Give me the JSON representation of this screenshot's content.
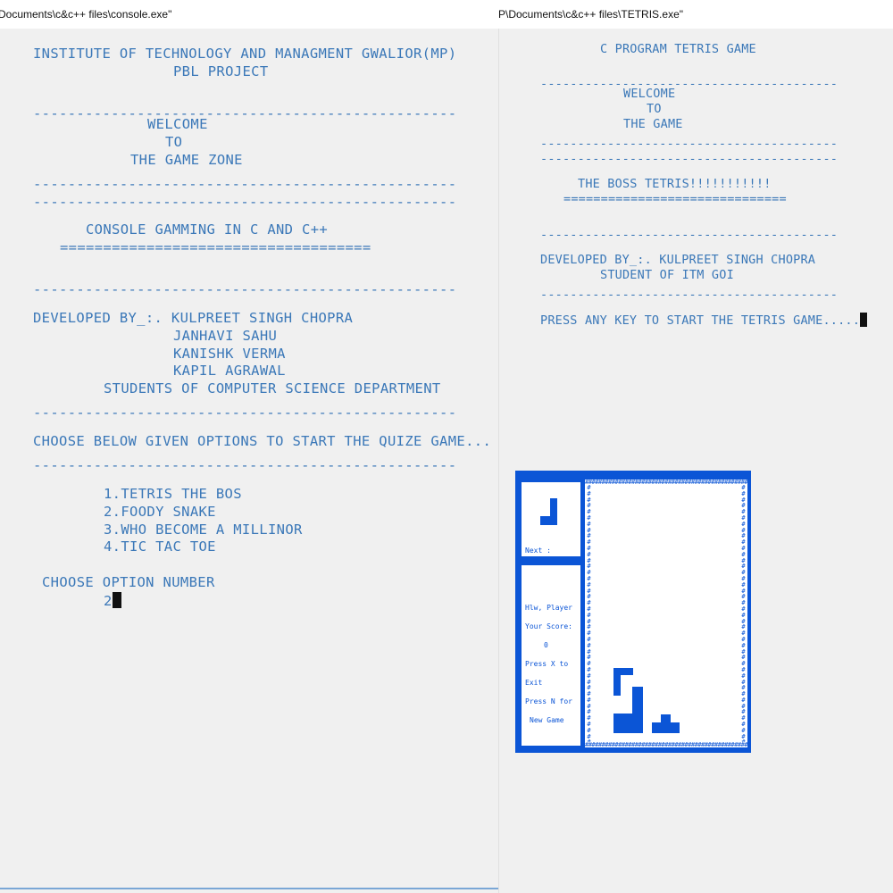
{
  "left_window": {
    "title": "Documents\\c&c++ files\\console.exe\"",
    "lines": [
      "INSTITUTE OF TECHNOLOGY AND MANAGMENT GWALIOR(MP)",
      "PBL PROJECT",
      "-------------------------------------------------",
      "WELCOME",
      "TO",
      "THE GAME ZONE",
      "-------------------------------------------------",
      "-------------------------------------------------",
      "CONSOLE GAMMING IN C AND C++",
      "====================================",
      "-------------------------------------------------",
      "DEVELOPED BY_:. KULPREET SINGH CHOPRA",
      "JANHAVI SAHU",
      "KANISHK VERMA",
      "KAPIL AGRAWAL",
      "STUDENTS OF COMPUTER SCIENCE DEPARTMENT",
      "-------------------------------------------------",
      "CHOOSE BELOW GIVEN OPTIONS TO START THE QUIZE GAME...",
      "-------------------------------------------------",
      "1.TETRIS THE BOS",
      "2.FOODY SNAKE",
      "3.WHO BECOME A MILLINOR",
      "4.TIC TAC TOE",
      "CHOOSE OPTION NUMBER",
      "2"
    ]
  },
  "right_window": {
    "title": "P\\Documents\\c&c++ files\\TETRIS.exe\"",
    "lines": [
      "C PROGRAM TETRIS GAME",
      "----------------------------------------",
      "WELCOME",
      "TO",
      "THE GAME",
      "----------------------------------------",
      "----------------------------------------",
      "THE BOSS TETRIS!!!!!!!!!!!",
      "==============================",
      "----------------------------------------",
      "DEVELOPED BY_:. KULPREET SINGH CHOPRA",
      "STUDENT OF ITM GOI",
      "----------------------------------------",
      "PRESS ANY KEY TO START THE TETRIS GAME....."
    ]
  },
  "tetris_preview": {
    "next_label": "Next :",
    "info_lines": [
      "Hlw, Player",
      "Your Score:",
      "0",
      "Press X to",
      "Exit",
      "Press N for",
      "New Game"
    ],
    "border_char": "#",
    "colors": {
      "blocks": "#0b55d6",
      "text": "#3b78b8",
      "background": "#f0f0f0"
    }
  }
}
